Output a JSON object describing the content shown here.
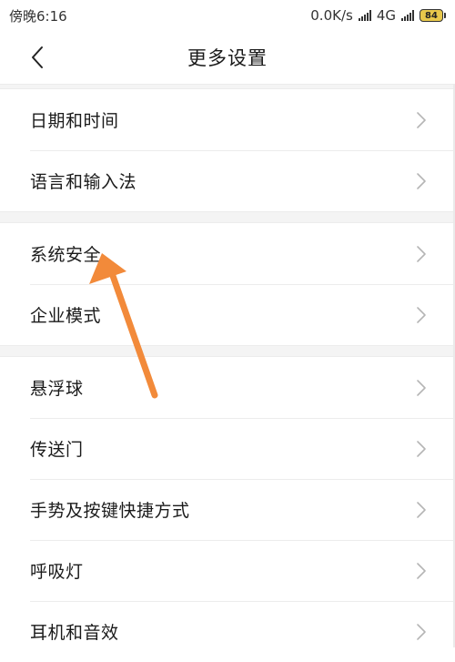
{
  "status_bar": {
    "time": "傍晚6:16",
    "net_speed": "0.0K/s",
    "net_type": "4G",
    "net_type_sub": "ıl",
    "battery": "84"
  },
  "header": {
    "title": "更多设置",
    "back_icon": "chevron-left-icon"
  },
  "groups": [
    {
      "items": [
        {
          "label": "日期和时间"
        },
        {
          "label": "语言和输入法"
        }
      ]
    },
    {
      "items": [
        {
          "label": "系统安全"
        },
        {
          "label": "企业模式"
        }
      ]
    },
    {
      "items": [
        {
          "label": "悬浮球"
        },
        {
          "label": "传送门"
        },
        {
          "label": "手势及按键快捷方式"
        },
        {
          "label": "呼吸灯"
        },
        {
          "label": "耳机和音效"
        }
      ]
    }
  ],
  "colors": {
    "annotation_arrow": "#f28a3a",
    "battery_fill": "#e8c84b",
    "divider_band": "#f4f4f4",
    "chevron": "#b5b5b5"
  }
}
